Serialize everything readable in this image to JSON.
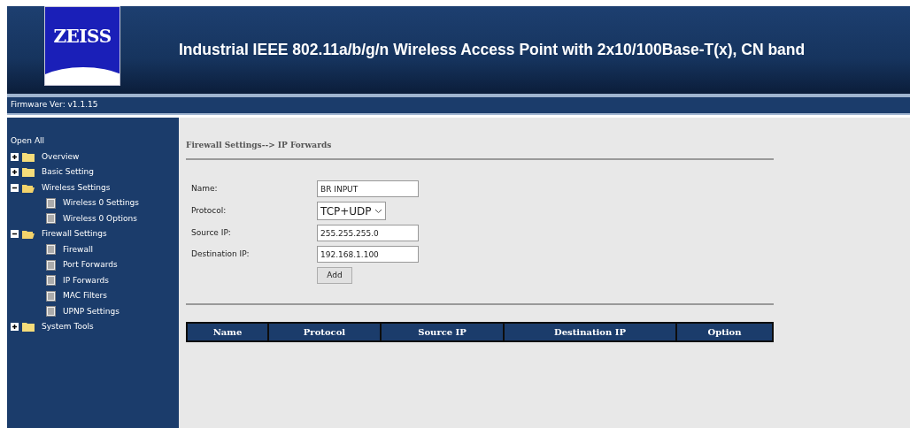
{
  "header": {
    "logo": "ZEISS",
    "title": "Industrial IEEE 802.11a/b/g/n Wireless Access Point with 2x10/100Base-T(x), CN band"
  },
  "firmware": "Firmware Ver: v1.1.15",
  "sidebar": {
    "open_all": "Open All",
    "items": [
      {
        "label": "Overview",
        "expanded": false
      },
      {
        "label": "Basic Setting",
        "expanded": false
      },
      {
        "label": "Wireless Settings",
        "expanded": true,
        "children": [
          {
            "label": "Wireless 0 Settings"
          },
          {
            "label": "Wireless 0 Options"
          }
        ]
      },
      {
        "label": "Firewall Settings",
        "expanded": true,
        "children": [
          {
            "label": "Firewall"
          },
          {
            "label": "Port Forwards"
          },
          {
            "label": "IP Forwards"
          },
          {
            "label": "MAC Filters"
          },
          {
            "label": "UPNP Settings"
          }
        ]
      },
      {
        "label": "System Tools",
        "expanded": false
      }
    ]
  },
  "breadcrumb": "Firewall Settings--> IP Forwards",
  "form": {
    "fields": [
      {
        "kind": "text",
        "label": "Name:",
        "value": "BR INPUT"
      },
      {
        "kind": "select",
        "label": "Protocol:",
        "value": "TCP+UDP"
      },
      {
        "kind": "text",
        "label": "Source IP:",
        "value": "255.255.255.0"
      },
      {
        "kind": "text",
        "label": "Destination IP:",
        "value": "192.168.1.100"
      }
    ],
    "button": "Add"
  },
  "table": {
    "columns": [
      "Name",
      "Protocol",
      "Source IP",
      "Destination IP",
      "Option"
    ]
  }
}
